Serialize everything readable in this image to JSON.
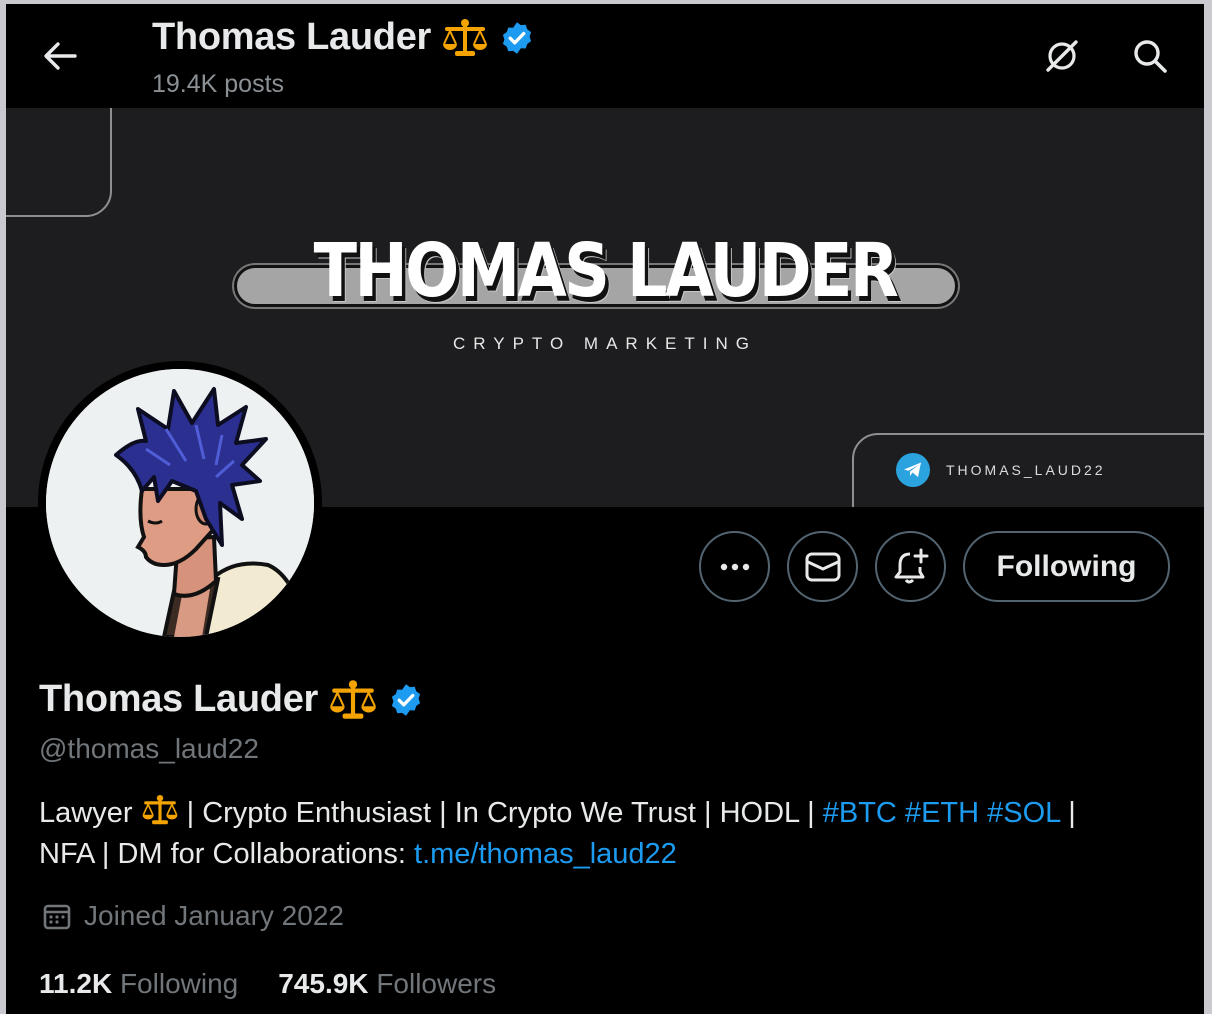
{
  "header": {
    "name": "Thomas Lauder",
    "posts": "19.4K posts"
  },
  "banner": {
    "title": "THOMAS LAUDER",
    "subtitle": "CRYPTO MARKETING",
    "telegram_handle": "THOMAS_LAUD22"
  },
  "actions": {
    "more_label": "•••",
    "following_label": "Following"
  },
  "profile": {
    "name": "Thomas Lauder",
    "handle": "@thomas_laud22",
    "bio": {
      "part1": "Lawyer",
      "part2": " | Crypto Enthusiast | In Crypto We Trust  | HODL | ",
      "hashtags": "#BTC #ETH #SOL",
      "part3": "  | ",
      "part4": "NFA | DM for Collaborations: ",
      "link": "t.me/thomas_laud22"
    },
    "joined": "Joined January 2022",
    "following_count": "11.2K",
    "following_label": "Following",
    "followers_count": "745.9K",
    "followers_label": "Followers"
  },
  "icons": {
    "back": "arrow-left-icon",
    "grok": "slashed-circle-icon",
    "search": "search-icon",
    "verified": "verified-badge-icon",
    "scale": "balance-scale-emoji",
    "telegram": "telegram-icon",
    "message": "envelope-icon",
    "notify": "bell-plus-icon",
    "calendar": "calendar-icon"
  },
  "colors": {
    "background": "#000000",
    "text": "#e7e9ea",
    "muted": "#71767b",
    "link": "#1d9bf0",
    "verified": "#1d9bf0",
    "border": "#536471",
    "banner": "#1d1d1f",
    "telegram": "#2aa3df"
  }
}
